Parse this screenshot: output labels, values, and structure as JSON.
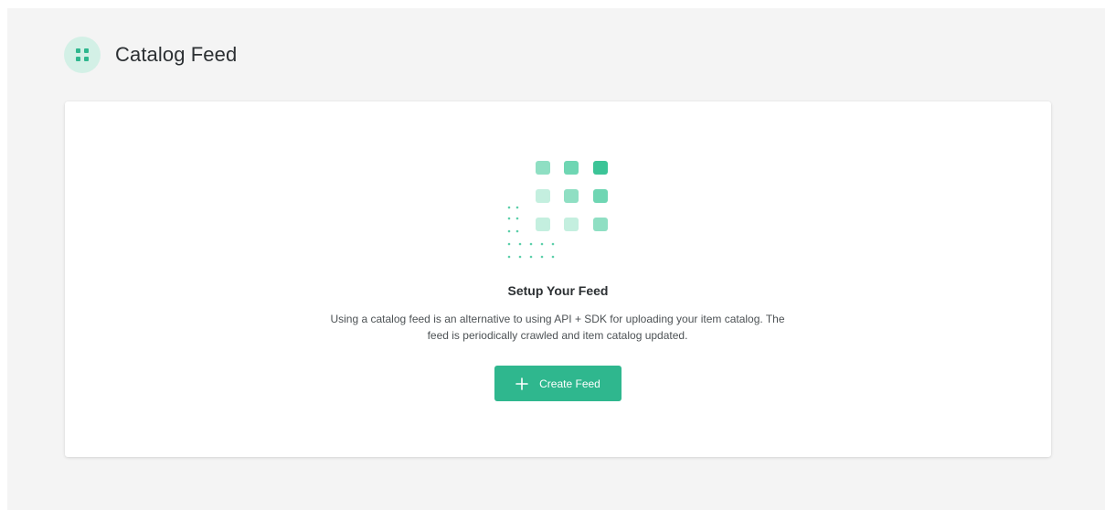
{
  "header": {
    "title": "Catalog Feed",
    "icon": "grid-icon"
  },
  "empty_state": {
    "illustration": "feed-grid-illustration",
    "title": "Setup Your Feed",
    "description": "Using a catalog feed is an alternative to using API + SDK for uploading your item catalog. The feed is periodically crawled and item catalog updated."
  },
  "actions": {
    "create_label": "Create Feed",
    "create_icon": "plus-icon"
  },
  "colors": {
    "accent": "#2fb78e",
    "accent_light": "#d3f0e6",
    "page_background": "#f4f4f4",
    "card_background": "#ffffff"
  }
}
